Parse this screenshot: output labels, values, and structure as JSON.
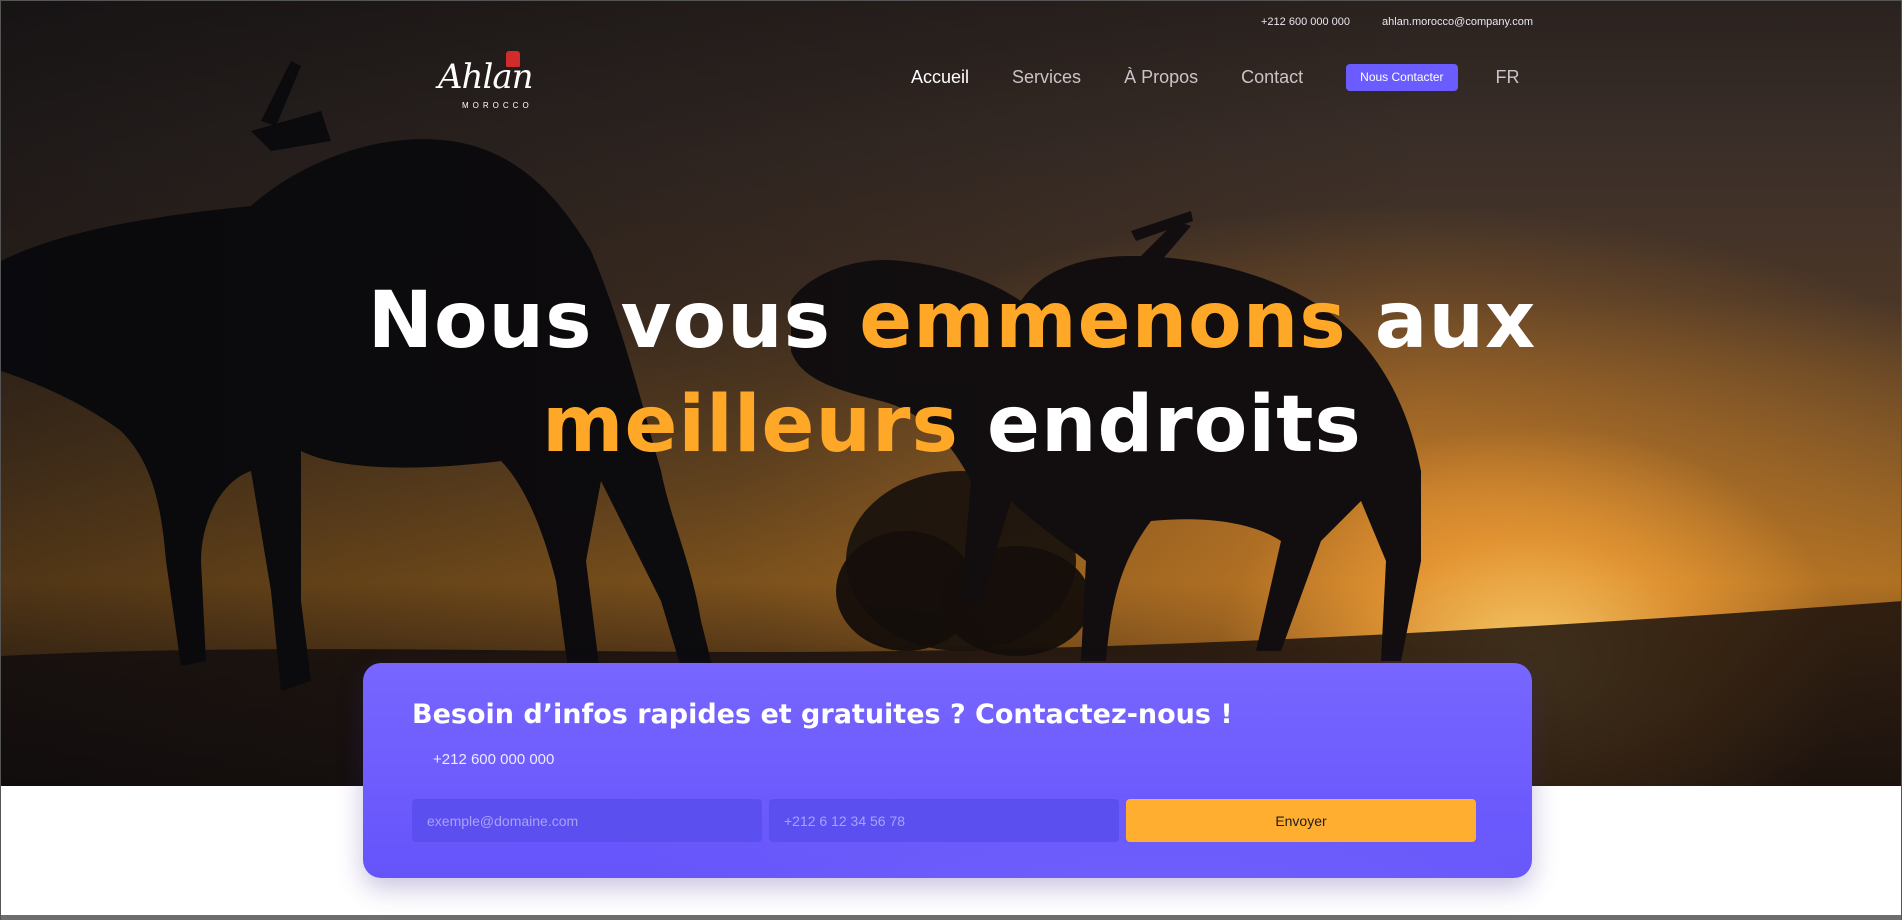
{
  "colors": {
    "accent": "#ffa727",
    "brand_purple": "#6a5cff",
    "send_button": "#ffae2f"
  },
  "topbar": {
    "phone": "+212 600 000 000",
    "email": "ahlan.morocco@company.com"
  },
  "logo": {
    "script": "Ahlan",
    "sub": "MOROCCO"
  },
  "nav": {
    "items": [
      {
        "label": "Accueil",
        "active": true
      },
      {
        "label": "Services",
        "active": false
      },
      {
        "label": "À Propos",
        "active": false
      },
      {
        "label": "Contact",
        "active": false
      }
    ],
    "cta_label": "Nous Contacter",
    "language": "FR"
  },
  "hero": {
    "line1_a": "Nous vous ",
    "line1_accent": "emmenons",
    "line1_b": " aux",
    "line2_accent": "meilleurs",
    "line2_b": " endroits"
  },
  "contact_card": {
    "title": "Besoin d’infos rapides et gratuites ? Contactez-nous !",
    "phone": "+212 600 000 000",
    "email_placeholder": "exemple@domaine.com",
    "phone_placeholder": "+212 6 12 34 56 78",
    "submit_label": "Envoyer"
  }
}
